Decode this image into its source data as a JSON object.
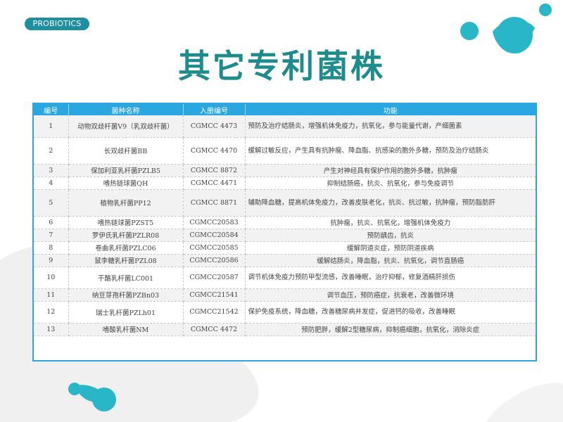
{
  "badge": {
    "label": "PROBIOTICS"
  },
  "title": "其它专利菌株",
  "table": {
    "headers": [
      "编号",
      "菌种名称",
      "入册编号",
      "功能"
    ],
    "rows": [
      {
        "no": "1",
        "name": "动物双歧杆菌V9（乳双歧杆菌）",
        "code": "CGMCC 4473",
        "func": "预防及治疗结肠炎，增强机体免疫力，抗氧化，参与能量代谢，产细菌素"
      },
      {
        "no": "2",
        "name": "长双歧杆菌BB",
        "code": "CGMCC 4470",
        "func": "缓解过敏反应，产生具有抗肿瘤、降血脂、抗感染的胞外多糖，预防及治疗结肠炎"
      },
      {
        "no": "3",
        "name": "保加利亚乳杆菌PZLB5",
        "code": "CGMCC 8872",
        "func": "产生对神经具有保护作用的胞外多糖，抗肿瘤"
      },
      {
        "no": "4",
        "name": "嗜热链球菌QH",
        "code": "CGMCC 4471",
        "func": "抑制结肠癌，抗炎、抗氧化，参与免疫调节"
      },
      {
        "no": "5",
        "name": "植物乳杆菌PP12",
        "code": "CGMCC 8871",
        "func": "辅助降血糖，提高机体免疫力，改善皮肤老化，抗炎、抗过敏，抗肿瘤，预防脂肪肝"
      },
      {
        "no": "6",
        "name": "嗜热链球菌PZST5",
        "code": "CGMCC20583",
        "func": "抗肿瘤，抗炎、抗氧化，增强机体免疫力"
      },
      {
        "no": "7",
        "name": "罗伊氏乳杆菌PZLR08",
        "code": "CGMCC20584",
        "func": "预防龋齿，抗炎"
      },
      {
        "no": "8",
        "name": "卷曲乳杆菌PZLC06",
        "code": "CGMCC20585",
        "func": "缓解阴道炎症，预防阴道疾病"
      },
      {
        "no": "9",
        "name": "鼠李糖乳杆菌PZL08",
        "code": "CGMCC20586",
        "func": "缓解结肠炎，降血脂，抗炎、抗氧化，调节直肠癌"
      },
      {
        "no": "10",
        "name": "干酪乳杆菌LC001",
        "code": "CGMCC20587",
        "func": "调节机体免疫力预防甲型流感，改善睡眠，治疗抑郁，修复酒精肝损伤"
      },
      {
        "no": "11",
        "name": "纳豆芽孢杆菌PZBn03",
        "code": "CGMCC21541",
        "func": "调节血压，预防癌症，抗衰老，改善微环境"
      },
      {
        "no": "12",
        "name": "瑞士乳杆菌PZLh01",
        "code": "CGMCC21542",
        "func": "保护免疫系统，降血糖，改善糖尿病并发症，促进钙的吸收，改善睡眠"
      },
      {
        "no": "13",
        "name": "嗜酸乳杆菌NM",
        "code": "CGMCC 4472",
        "func": "预防肥胖，缓解2型糖尿病，抑制癌细胞，抗氧化，消除炎症"
      }
    ]
  },
  "colors": {
    "title": "#1e8c8c",
    "badge": "#1e8fa0",
    "header": "#2aa7e0",
    "blob": "#29b6c8"
  }
}
